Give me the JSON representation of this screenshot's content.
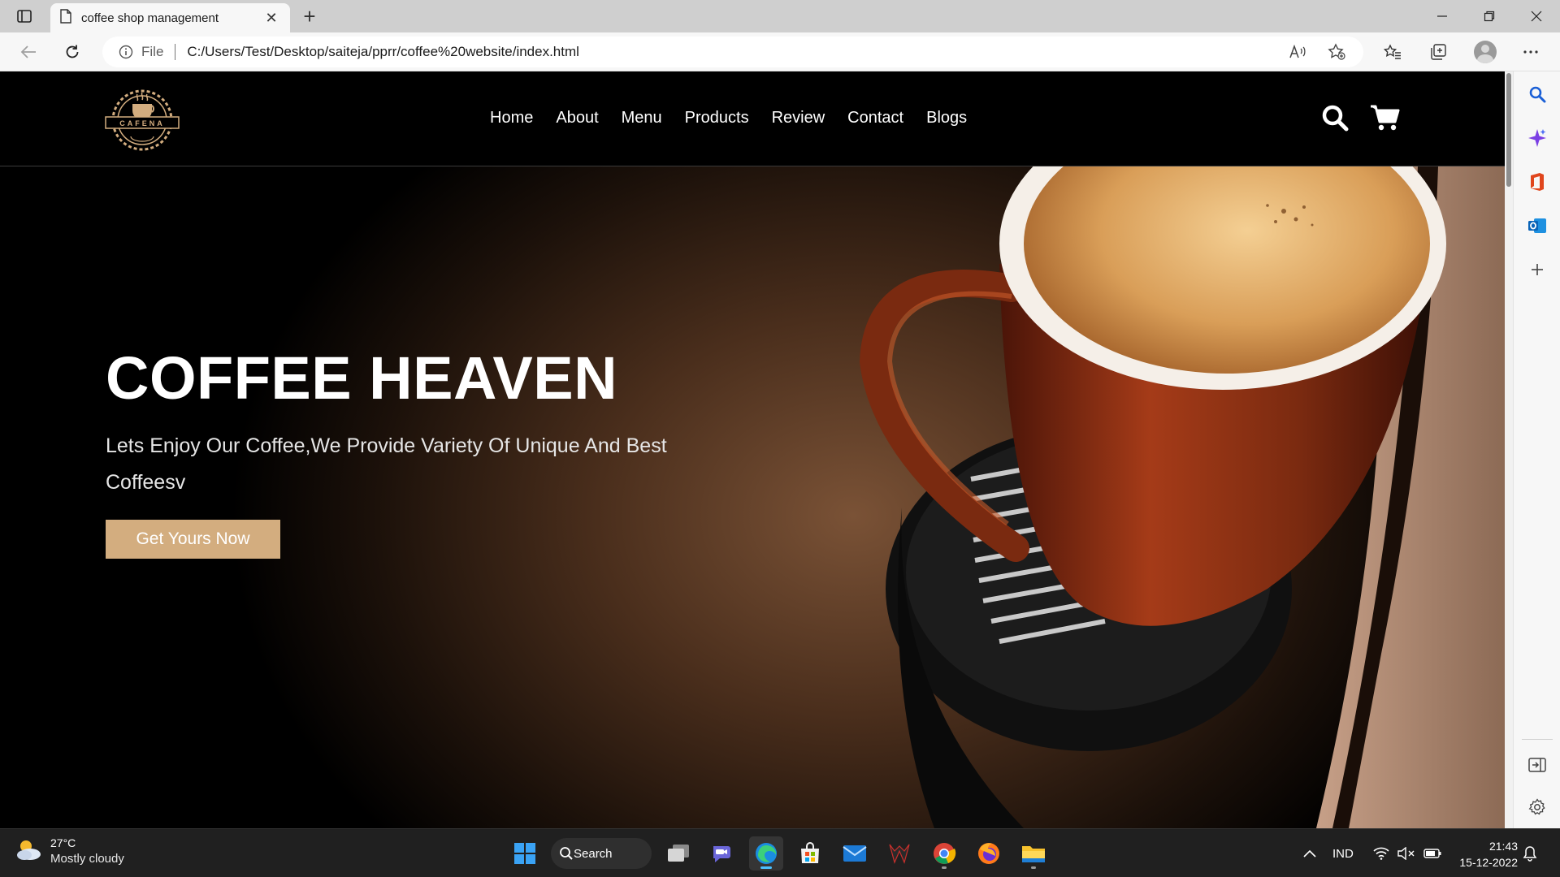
{
  "browser": {
    "tab_title": "coffee shop management",
    "address_prefix": "File",
    "url": "C:/Users/Test/Desktop/saiteja/pprr/coffee%20website/index.html"
  },
  "site": {
    "nav": [
      "Home",
      "About",
      "Menu",
      "Products",
      "Review",
      "Contact",
      "Blogs"
    ],
    "logo_text": "CAFENA",
    "hero": {
      "title": "COFFEE HEAVEN",
      "subtitle": "Lets Enjoy Our Coffee,We Provide Variety Of Unique And Best Coffeesv",
      "cta": "Get Yours Now"
    },
    "colors": {
      "accent": "#d3ad7f",
      "header_bg": "#000000"
    }
  },
  "taskbar": {
    "weather_temp": "27°C",
    "weather_condition": "Mostly cloudy",
    "search_label": "Search",
    "language": "IND",
    "time": "21:43",
    "date": "15-12-2022"
  }
}
